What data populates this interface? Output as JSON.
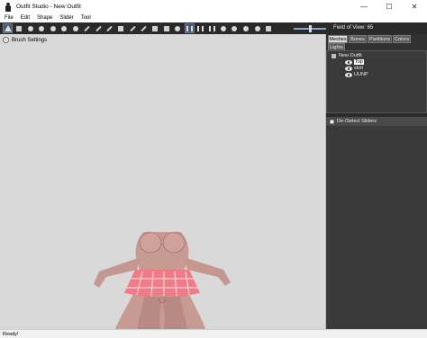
{
  "window": {
    "title": "Outfit Studio - New Outfit",
    "controls": {
      "minimize": "—",
      "maximize": "☐",
      "close": "✕"
    }
  },
  "menu": [
    "File",
    "Edit",
    "Shape",
    "Slider",
    "Tool"
  ],
  "toolbar": {
    "tools": [
      {
        "name": "select-tool",
        "active": true
      },
      {
        "name": "mask-brush",
        "active": false
      },
      {
        "name": "inflate-brush",
        "active": false
      },
      {
        "name": "deflate-brush",
        "active": false
      },
      {
        "name": "move-brush",
        "active": false
      },
      {
        "name": "smooth-brush",
        "active": false
      },
      {
        "name": "undiff-brush",
        "active": false
      },
      {
        "name": "weight-brush",
        "active": false
      },
      {
        "name": "color-brush",
        "active": false
      },
      {
        "name": "alpha-brush",
        "active": false
      },
      {
        "name": "collapse-vertex",
        "active": false
      },
      {
        "name": "flip-edge",
        "active": false
      },
      {
        "name": "split-edge",
        "active": false
      },
      {
        "name": "move-tool",
        "active": false
      },
      {
        "name": "scale-tool",
        "active": false
      },
      {
        "name": "rotate-tool",
        "active": false
      },
      {
        "name": "x-mirror",
        "active": true
      },
      {
        "name": "connected-only",
        "active": false
      },
      {
        "name": "global-brush",
        "active": false
      },
      {
        "name": "view-front",
        "active": false
      },
      {
        "name": "view-back",
        "active": false
      },
      {
        "name": "view-left",
        "active": false
      },
      {
        "name": "view-right",
        "active": false
      },
      {
        "name": "toggle-perspective",
        "active": false
      }
    ],
    "fov_label": "Field of View: 65"
  },
  "viewport": {
    "brush_settings_label": "Brush Settings",
    "background": "#d9d9d9"
  },
  "right_panel": {
    "tabs": [
      "Meshes",
      "Bones",
      "Partitions",
      "Colors",
      "Lights"
    ],
    "active_tab": "Meshes",
    "tree": {
      "root": "New Outfit",
      "items": [
        "Top",
        "skirt",
        "UUNP"
      ],
      "selected": "Top"
    },
    "sliders_header": "De-/Select Sliders"
  },
  "status": "Ready!",
  "colors": {
    "toolbar_bg": "#2a2a2a",
    "panel_bg": "#3a3a3a",
    "skin": "#c79a92",
    "skirt": "#f07a85"
  }
}
